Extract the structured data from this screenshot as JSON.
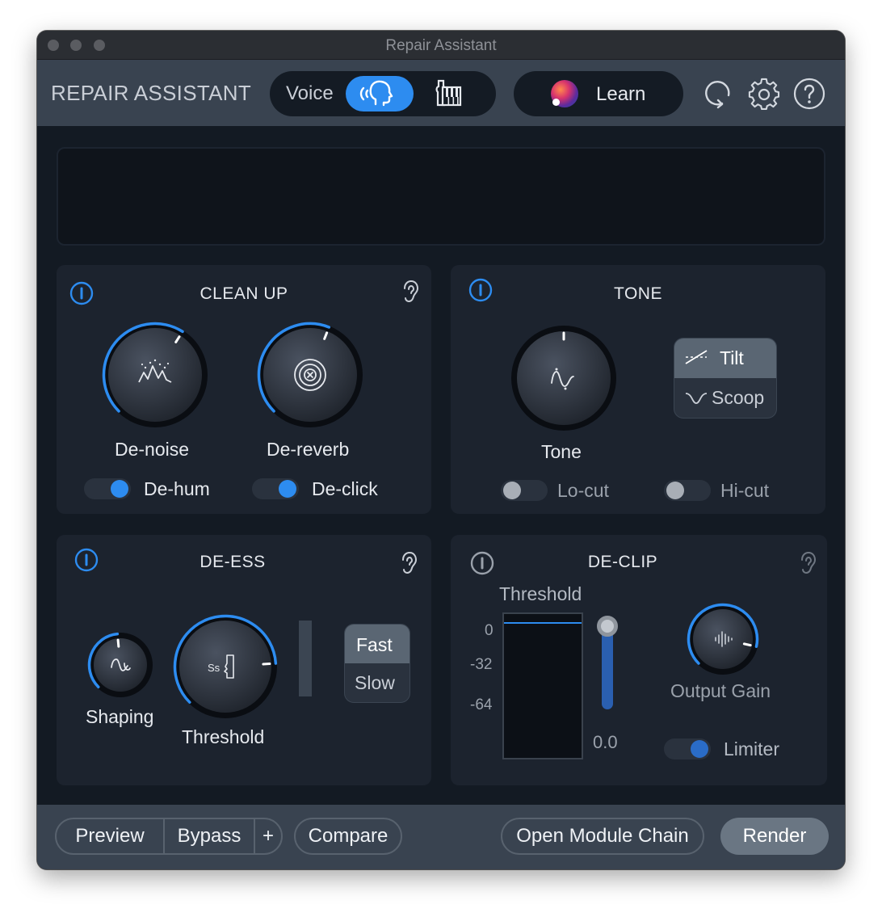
{
  "window": {
    "title": "Repair Assistant"
  },
  "header": {
    "app_title": "REPAIR ASSISTANT",
    "voice_label": "Voice",
    "learn_label": "Learn",
    "icons": [
      "voice-head-icon",
      "music-piano-icon",
      "reset-icon",
      "gear-icon",
      "help-icon"
    ]
  },
  "cleanup": {
    "title": "CLEAN UP",
    "denoise_label": "De-noise",
    "denoise_level": 0.62,
    "dereverb_label": "De-reverb",
    "dereverb_level": 0.58,
    "dehum_label": "De-hum",
    "dehum_on": true,
    "declick_label": "De-click",
    "declick_on": true
  },
  "tone": {
    "title": "TONE",
    "tone_label": "Tone",
    "tone_level": 0.5,
    "modes": [
      "Tilt",
      "Scoop"
    ],
    "selected_mode": "Tilt",
    "locut_label": "Lo-cut",
    "locut_on": false,
    "hicut_label": "Hi-cut",
    "hicut_on": false
  },
  "deess": {
    "title": "DE-ESS",
    "shaping_label": "Shaping",
    "shaping_level": 0.48,
    "threshold_label": "Threshold",
    "threshold_level": 0.82,
    "speeds": [
      "Fast",
      "Slow"
    ],
    "selected_speed": "Fast"
  },
  "declip": {
    "title": "DE-CLIP",
    "threshold_label": "Threshold",
    "scale_labels": [
      "0",
      "-32",
      "-64"
    ],
    "threshold_value": "0.0",
    "output_gain_label": "Output Gain",
    "output_gain_level": 0.88,
    "limiter_label": "Limiter",
    "limiter_on": true
  },
  "footer": {
    "preview": "Preview",
    "bypass": "Bypass",
    "plus": "+",
    "compare": "Compare",
    "open_chain": "Open Module Chain",
    "render": "Render"
  },
  "colors": {
    "accent": "#2d8cf0",
    "panel": "#1c232e",
    "background": "#131a23",
    "header": "#394350"
  }
}
